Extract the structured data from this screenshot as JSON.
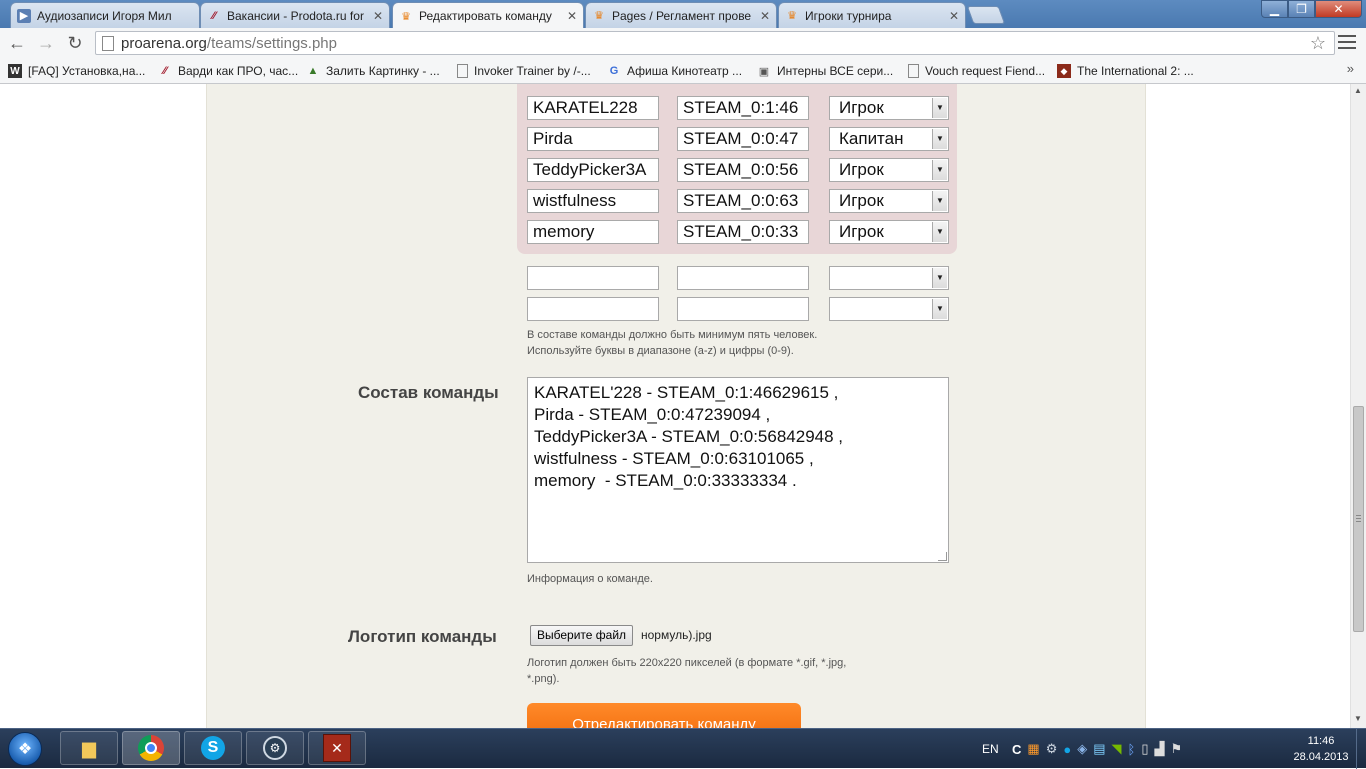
{
  "browser": {
    "tabs": [
      {
        "title": "Аудиозаписи Игоря Мил",
        "icon": "play-icon",
        "active": false
      },
      {
        "title": "Вакансии - Prodota.ru for",
        "icon": "prodota-icon",
        "active": false
      },
      {
        "title": "Редактировать команду",
        "icon": "crown-icon",
        "active": true
      },
      {
        "title": "Pages / Регламент прове",
        "icon": "crown-icon",
        "active": false
      },
      {
        "title": "Игроки турнира",
        "icon": "crown-icon",
        "active": false
      }
    ],
    "address": {
      "host": "proarena.org",
      "path": "/teams/settings.php"
    },
    "bookmarks": [
      {
        "label": "[FAQ] Установка,на...",
        "icon": "w-icon"
      },
      {
        "label": "Варди как ПРО, час...",
        "icon": "prodota-icon"
      },
      {
        "label": "Залить Картинку - ...",
        "icon": "image-icon"
      },
      {
        "label": "Invoker Trainer by /-...",
        "icon": "page-icon"
      },
      {
        "label": "Афиша Кинотеатр ...",
        "icon": "google-icon"
      },
      {
        "label": "Интерны ВСЕ сери...",
        "icon": "video-icon"
      },
      {
        "label": "Vouch request Fiend...",
        "icon": "page-icon"
      },
      {
        "label": "The International 2: ...",
        "icon": "dota-icon"
      }
    ],
    "bookmarks_more": "»"
  },
  "members": {
    "rows": [
      {
        "nick": "KARATEL228",
        "steam": "STEAM_0:1:46",
        "role": "Игрок"
      },
      {
        "nick": "Pirda",
        "steam": "STEAM_0:0:47",
        "role": "Капитан"
      },
      {
        "nick": "TeddyPicker3A",
        "steam": "STEAM_0:0:56",
        "role": "Игрок"
      },
      {
        "nick": "wistfulness",
        "steam": "STEAM_0:0:63",
        "role": "Игрок"
      },
      {
        "nick": "memory",
        "steam": "STEAM_0:0:33",
        "role": "Игрок"
      }
    ],
    "empty_rows": [
      {
        "nick": "",
        "steam": "",
        "role": ""
      },
      {
        "nick": "",
        "steam": "",
        "role": ""
      }
    ],
    "hint_line1": "В составе команды должно быть минимум пять человек.",
    "hint_line2": "Используйте буквы в диапазоне (a-z) и цифры (0-9)."
  },
  "roster": {
    "label": "Состав команды",
    "text": "KARATEL'228 - STEAM_0:1:46629615 ,\nPirda - STEAM_0:0:47239094 ,\nTeddyPicker3A - STEAM_0:0:56842948 ,\nwistfulness - STEAM_0:0:63101065 ,\nmemory  - STEAM_0:0:33333334 .",
    "hint": "Информация о команде."
  },
  "logo": {
    "label": "Логотип команды",
    "button": "Выберите файл",
    "filename": "нормуль).jpg",
    "hint_line1": "Логотип должен быть 220x220 пикселей (в формате *.gif, *.jpg,",
    "hint_line2": "*.png)."
  },
  "submit_label": "Отредактировать команду",
  "taskbar": {
    "lang": "EN",
    "time": "11:46",
    "date": "28.04.2013"
  }
}
